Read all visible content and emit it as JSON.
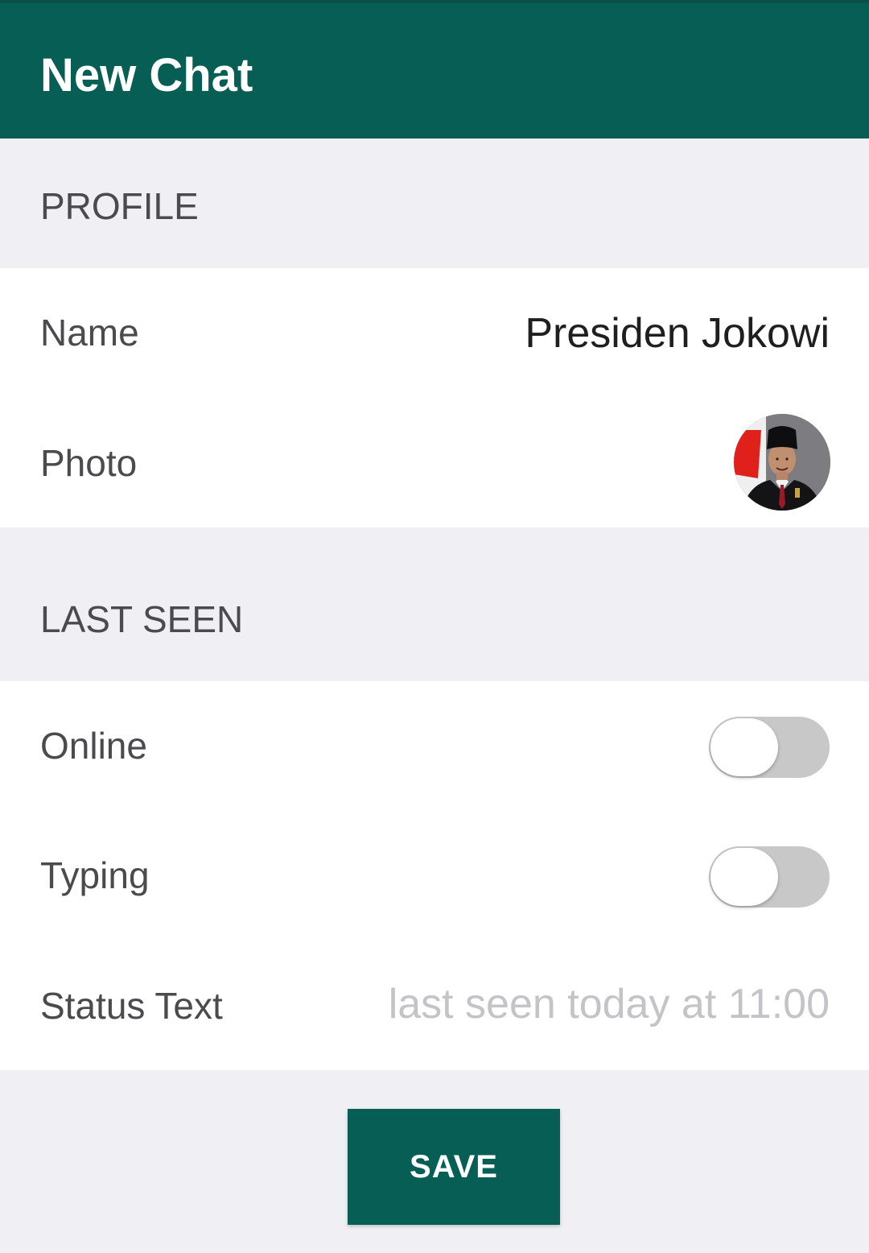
{
  "toolbar": {
    "title": "New Chat"
  },
  "sections": {
    "profile": {
      "header": "PROFILE",
      "name_label": "Name",
      "name_value": "Presiden Jokowi",
      "photo_label": "Photo"
    },
    "last_seen": {
      "header": "LAST SEEN",
      "online_label": "Online",
      "online_enabled": false,
      "typing_label": "Typing",
      "typing_enabled": false,
      "status_label": "Status Text",
      "status_placeholder": "last seen today at 11:00"
    }
  },
  "actions": {
    "save_label": "SAVE"
  },
  "colors": {
    "primary": "#075e54",
    "background": "#efeff4",
    "toggle_off": "#c8c8c8"
  }
}
